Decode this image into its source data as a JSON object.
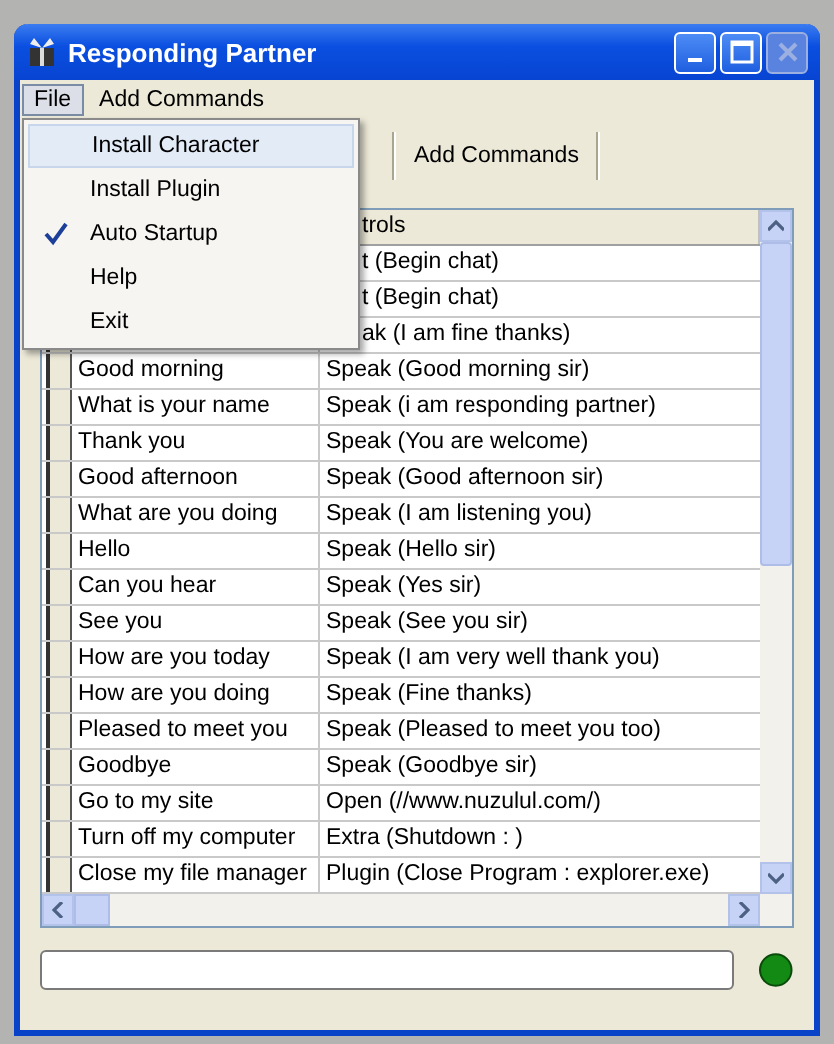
{
  "window": {
    "title": "Responding Partner",
    "close_disabled": true
  },
  "menu_bar": [
    {
      "label": "File",
      "selected": true
    },
    {
      "label": "Add Commands",
      "selected": false
    }
  ],
  "file_menu": [
    {
      "label": "Install Character",
      "selected": true,
      "checked": false
    },
    {
      "label": "Install Plugin",
      "selected": false,
      "checked": false
    },
    {
      "label": "Auto Startup",
      "selected": false,
      "checked": true
    },
    {
      "label": "Help",
      "selected": false,
      "checked": false
    },
    {
      "label": "Exit",
      "selected": false,
      "checked": false
    }
  ],
  "toolbar": [
    {
      "label": "Add Commands"
    }
  ],
  "table": {
    "column_2": "trols",
    "rows": [
      {
        "action": "t (Begin chat)"
      },
      {
        "action": "t (Begin chat)"
      },
      {
        "action": "ak (I am fine thanks)"
      },
      {
        "trigger": "Good morning",
        "action": "Speak (Good morning sir)"
      },
      {
        "trigger": "What is your name",
        "action": "Speak (i am responding partner)"
      },
      {
        "trigger": "Thank you",
        "action": "Speak (You are welcome)"
      },
      {
        "trigger": "Good afternoon",
        "action": "Speak (Good afternoon sir)"
      },
      {
        "trigger": "What are you doing",
        "action": "Speak (I am listening you)"
      },
      {
        "trigger": "Hello",
        "action": "Speak (Hello sir)"
      },
      {
        "trigger": "Can you hear",
        "action": "Speak (Yes sir)"
      },
      {
        "trigger": "See you",
        "action": "Speak (See you sir)"
      },
      {
        "trigger": "How are you today",
        "action": "Speak (I am very well thank you)"
      },
      {
        "trigger": "How are you doing",
        "action": "Speak (Fine thanks)"
      },
      {
        "trigger": "Pleased to meet you",
        "action": "Speak (Pleased to meet you too)"
      },
      {
        "trigger": "Goodbye",
        "action": "Speak (Goodbye sir)"
      },
      {
        "trigger": "Go to my site",
        "action": "Open (//www.nuzulul.com/)"
      },
      {
        "trigger": "Turn off my computer",
        "action": "Extra (Shutdown : )"
      },
      {
        "trigger": "Close my file manager",
        "action": "Plugin (Close Program : explorer.exe)"
      }
    ]
  }
}
